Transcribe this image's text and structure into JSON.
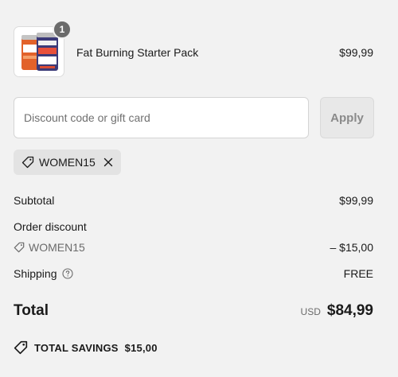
{
  "product": {
    "name": "Fat Burning Starter Pack",
    "price": "$99,99",
    "quantity": "1",
    "image_icon": "supplement-jars-icon"
  },
  "discount_form": {
    "placeholder": "Discount code or gift card",
    "apply_label": "Apply"
  },
  "applied_code": {
    "label": "WOMEN15",
    "icon": "tag-icon",
    "remove_icon": "close-icon"
  },
  "summary": {
    "subtotal_label": "Subtotal",
    "subtotal_value": "$99,99",
    "order_discount_label": "Order discount",
    "discount_code": "WOMEN15",
    "discount_amount": "– $15,00",
    "shipping_label": "Shipping",
    "shipping_value": "FREE",
    "total_label": "Total",
    "total_currency": "USD",
    "total_amount": "$84,99",
    "savings_label": "TOTAL SAVINGS",
    "savings_amount": "$15,00"
  },
  "colors": {
    "background": "#f2f2f2",
    "badge": "#6b6b6b",
    "muted_text": "#6b6b6b",
    "chip_background": "#e3e3e3"
  }
}
